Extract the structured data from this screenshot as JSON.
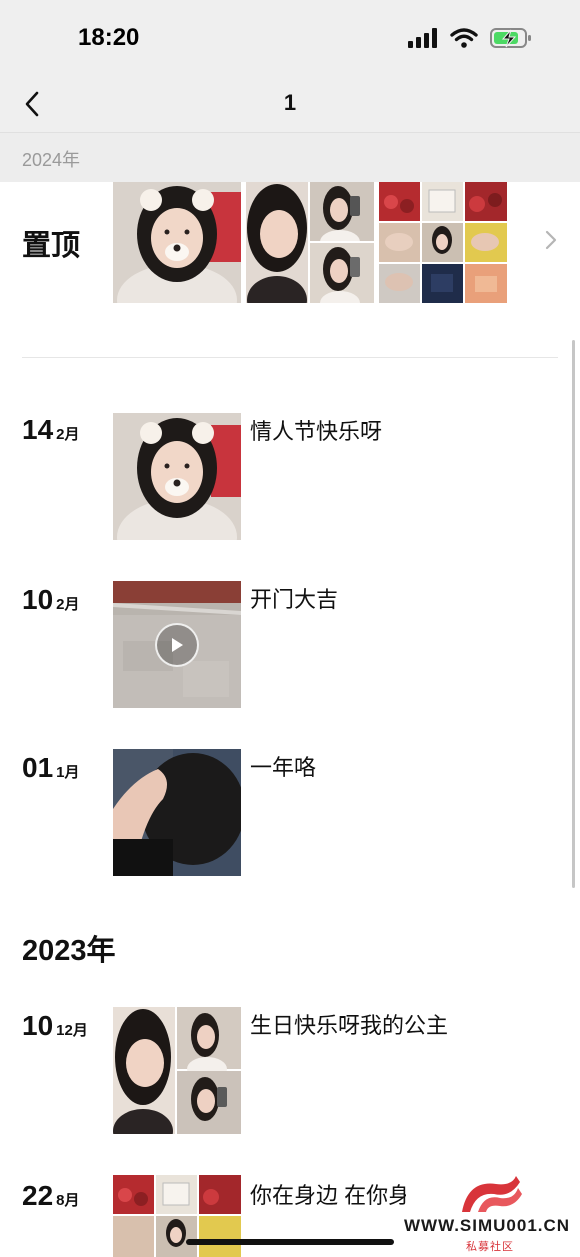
{
  "status_bar": {
    "time": "18:20",
    "icons": [
      "signal-icon",
      "wifi-icon",
      "battery-charging-icon"
    ]
  },
  "nav": {
    "title": "1",
    "back_icon": "chevron-left-icon"
  },
  "sticky_year": "2024年",
  "pinned": {
    "label": "置顶",
    "chevron_icon": "chevron-right-icon"
  },
  "entries": [
    {
      "day": "14",
      "month": "2月",
      "text": "情人节快乐呀"
    },
    {
      "day": "10",
      "month": "2月",
      "text": "开门大吉"
    },
    {
      "day": "01",
      "month": "1月",
      "text": "一年咯"
    }
  ],
  "year_2023": "2023年",
  "entries_2023": [
    {
      "day": "10",
      "month": "12月",
      "text": "生日快乐呀我的公主"
    },
    {
      "day": "22",
      "month": "8月",
      "text": "你在身边 在你身"
    }
  ],
  "watermark": {
    "url": "WWW.SIMU001.CN",
    "sub": "私募社区"
  },
  "colors": {
    "nav_bg": "#efefef",
    "sticky_bg": "#ededed",
    "muted_text": "#9a9a9a",
    "battery_green": "#4cd964",
    "watermark_red": "#d8343a"
  }
}
